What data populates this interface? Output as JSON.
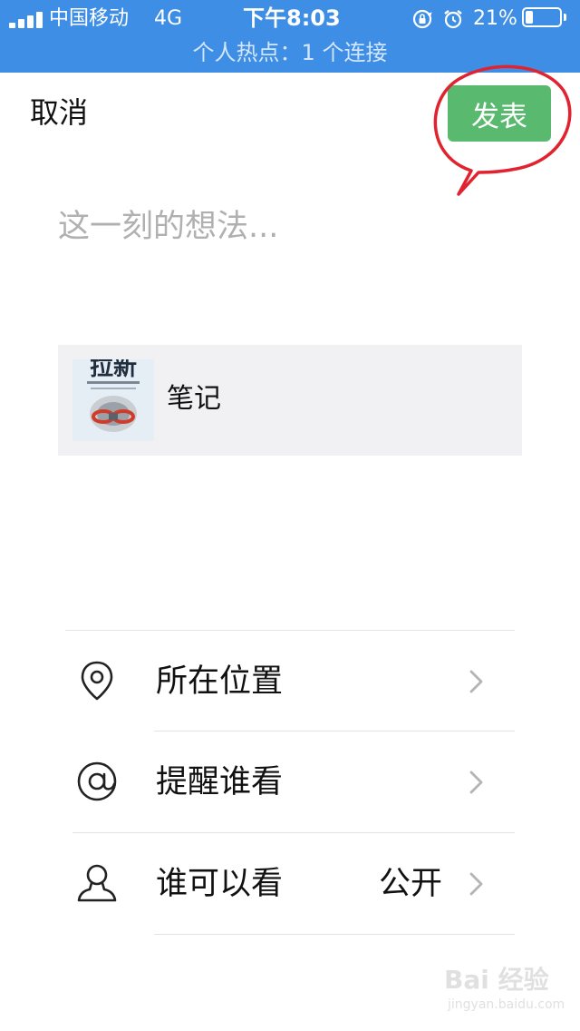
{
  "status_bar": {
    "carrier": "中国移动",
    "network": "4G",
    "time": "下午8:03",
    "battery_percent": "21%",
    "battery_level": 0.21,
    "hotspot_text": "个人热点：1 个连接",
    "background_color": "#3e8ee6"
  },
  "header": {
    "cancel_label": "取消",
    "publish_label": "发表",
    "publish_color": "#59b96f",
    "annotation_color": "#e0232f"
  },
  "composer": {
    "placeholder": "这一刻的想法...",
    "value": ""
  },
  "attachment": {
    "thumbnail_title": "拉新",
    "label": "笔记"
  },
  "options": [
    {
      "icon": "location-pin-icon",
      "label": "所在位置",
      "value": ""
    },
    {
      "icon": "at-mention-icon",
      "label": "提醒谁看",
      "value": ""
    },
    {
      "icon": "person-icon",
      "label": "谁可以看",
      "value": "公开"
    }
  ],
  "watermark": {
    "brand": "Bai 经验",
    "site": "jingyan.baidu.com"
  }
}
